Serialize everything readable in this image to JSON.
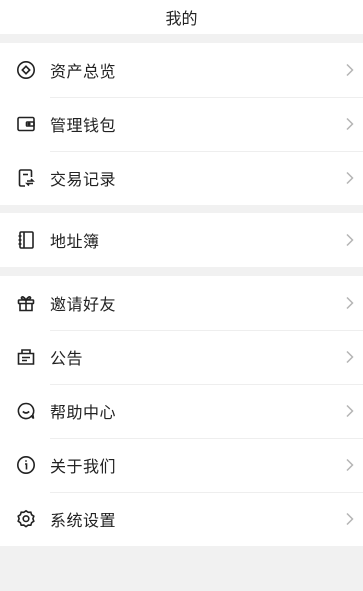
{
  "header": {
    "title": "我的"
  },
  "groups": [
    {
      "items": [
        {
          "label": "资产总览",
          "icon": "asset-overview-icon"
        },
        {
          "label": "管理钱包",
          "icon": "wallet-icon"
        },
        {
          "label": "交易记录",
          "icon": "transaction-record-icon"
        }
      ]
    },
    {
      "items": [
        {
          "label": "地址簿",
          "icon": "address-book-icon"
        }
      ]
    },
    {
      "items": [
        {
          "label": "邀请好友",
          "icon": "gift-icon"
        },
        {
          "label": "公告",
          "icon": "announcement-icon"
        },
        {
          "label": "帮助中心",
          "icon": "help-icon"
        },
        {
          "label": "关于我们",
          "icon": "info-icon"
        },
        {
          "label": "系统设置",
          "icon": "gear-icon"
        }
      ]
    }
  ],
  "colors": {
    "background": "#f1f1f1",
    "surface": "#ffffff",
    "text": "#222222",
    "chevron": "#b5b5b5",
    "divider": "#eeeeee"
  }
}
